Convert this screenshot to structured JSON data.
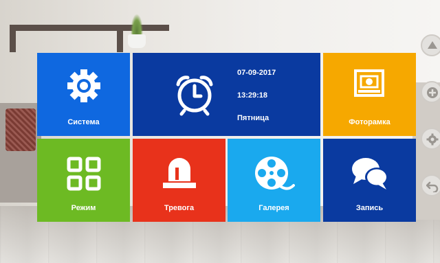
{
  "tiles": {
    "sistema": {
      "label": "Система",
      "icon": "gear-icon",
      "color": "#0f68e0"
    },
    "clock": {
      "icon": "alarm-clock-icon",
      "date": "07-09-2017",
      "time": "13:29:18",
      "weekday": "Пятница",
      "color": "#0a3aa0"
    },
    "foto": {
      "label": "Фоторамка",
      "icon": "photo-frame-icon",
      "color": "#f6a800"
    },
    "rezhim": {
      "label": "Режим",
      "icon": "grid-icon",
      "color": "#6dba23"
    },
    "trevoga": {
      "label": "Тревога",
      "icon": "siren-icon",
      "color": "#e8321b"
    },
    "galereya": {
      "label": "Галерея",
      "icon": "film-reel-icon",
      "color": "#1aa9ee"
    },
    "zapis": {
      "label": "Запись",
      "icon": "chat-bubbles-icon",
      "color": "#0a3aa0"
    }
  },
  "side_buttons": [
    {
      "icon": "eject-triangle-icon"
    },
    {
      "icon": "plus-circle-icon"
    },
    {
      "icon": "gear-icon"
    },
    {
      "icon": "back-arrow-icon"
    }
  ]
}
